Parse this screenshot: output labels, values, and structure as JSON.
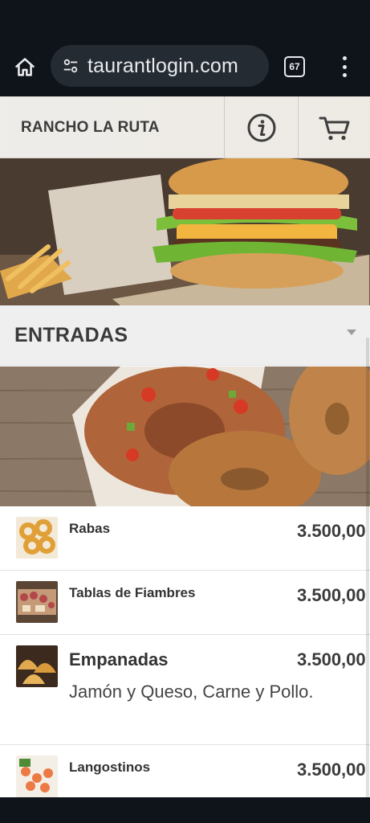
{
  "browser": {
    "url": "taurantlogin.com",
    "tab_count": "67",
    "icons": [
      "home-icon",
      "site-settings-icon",
      "tabs-icon",
      "more-vert-icon"
    ]
  },
  "site": {
    "brand": "RANCHO LA RUTA",
    "icons": [
      "info-icon",
      "cart-icon"
    ]
  },
  "section": {
    "title": "ENTRADAS"
  },
  "menu": {
    "items": [
      {
        "name": "Rabas",
        "price": "3.500,00",
        "description": ""
      },
      {
        "name": "Tablas de Fiambres",
        "price": "3.500,00",
        "description": ""
      },
      {
        "name": "Empanadas",
        "price": "3.500,00",
        "description": "Jamón y Queso, Carne y Pollo."
      },
      {
        "name": "Langostinos",
        "price": "3.500,00",
        "description": ""
      }
    ]
  },
  "colors": {
    "chrome_bg": "#0f131a",
    "url_pill": "#252b33",
    "section_bar": "#efefef",
    "text_dark": "#3b3b3b"
  }
}
